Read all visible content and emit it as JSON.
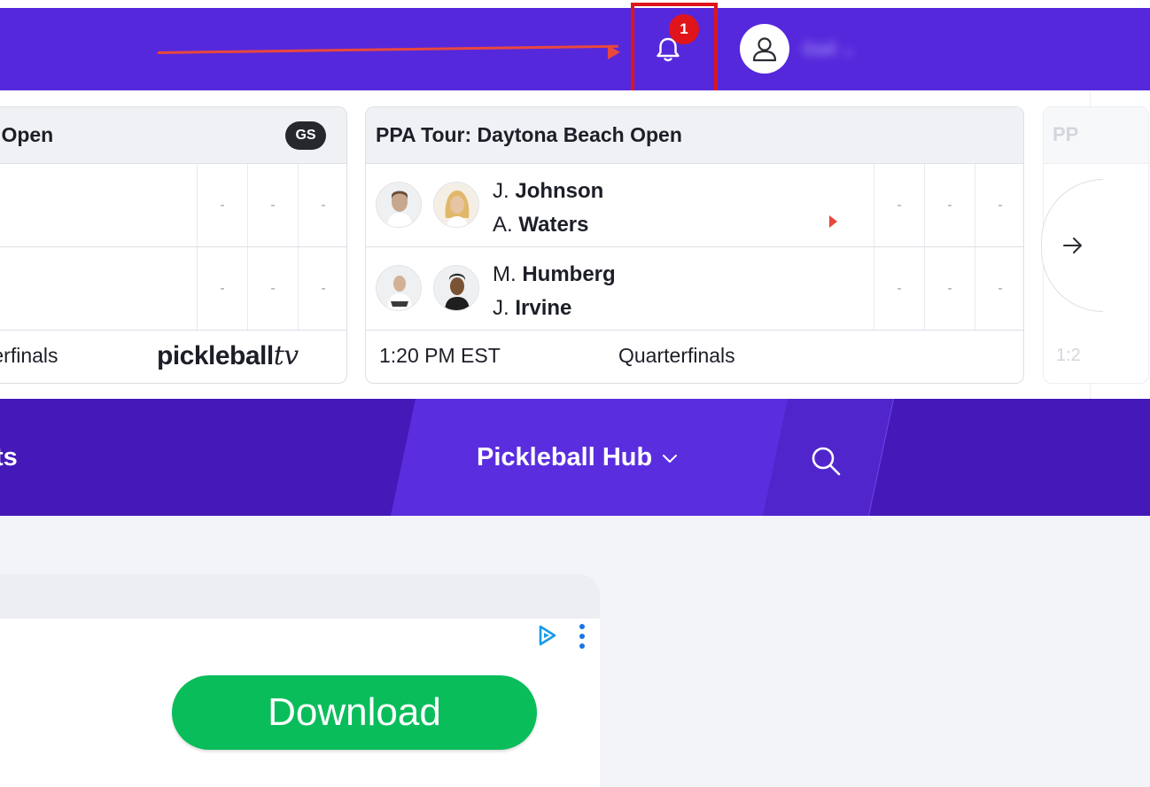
{
  "colors": {
    "brand_purple": "#5628dc",
    "nav_purple": "#4419b8",
    "highlight_red": "#e0151b",
    "download_green": "#0abd5b"
  },
  "header": {
    "notifications": {
      "icon": "bell-icon",
      "badge_count": "1"
    },
    "user": {
      "icon": "user-avatar-icon",
      "name": "Gail",
      "dropdown_icon": "chevron-down-icon"
    }
  },
  "scores": {
    "cards": [
      {
        "title": "n Open",
        "badge": "GS",
        "rows": [
          {
            "scores": [
              "-",
              "-",
              "-"
            ]
          },
          {
            "scores": [
              "-",
              "-",
              "-"
            ]
          }
        ],
        "footer_round": "terfinals",
        "footer_logo": {
          "main": "pickleball",
          "suffix": "tv"
        }
      },
      {
        "title": "PPA Tour: Daytona Beach Open",
        "rows": [
          {
            "players": [
              {
                "initial": "J.",
                "last": "Johnson"
              },
              {
                "initial": "A.",
                "last": "Waters"
              }
            ],
            "scores": [
              "-",
              "-",
              "-"
            ]
          },
          {
            "players": [
              {
                "initial": "M.",
                "last": "Humberg"
              },
              {
                "initial": "J.",
                "last": "Irvine"
              }
            ],
            "scores": [
              "-",
              "-",
              "-"
            ]
          }
        ],
        "footer_time": "1:20 PM EST",
        "footer_round": "Quarterfinals"
      },
      {
        "title": "PP",
        "footer_time": "1:2"
      }
    ],
    "next_icon": "arrow-right-icon"
  },
  "nav": {
    "partial_item": "ts",
    "hub_label": "Pickleball Hub",
    "hub_icon": "chevron-down-icon",
    "search_icon": "search-icon"
  },
  "ad": {
    "adchoices_icon": "adchoices-icon",
    "menu_icon": "kebab-menu-icon",
    "button_label": "Download"
  }
}
